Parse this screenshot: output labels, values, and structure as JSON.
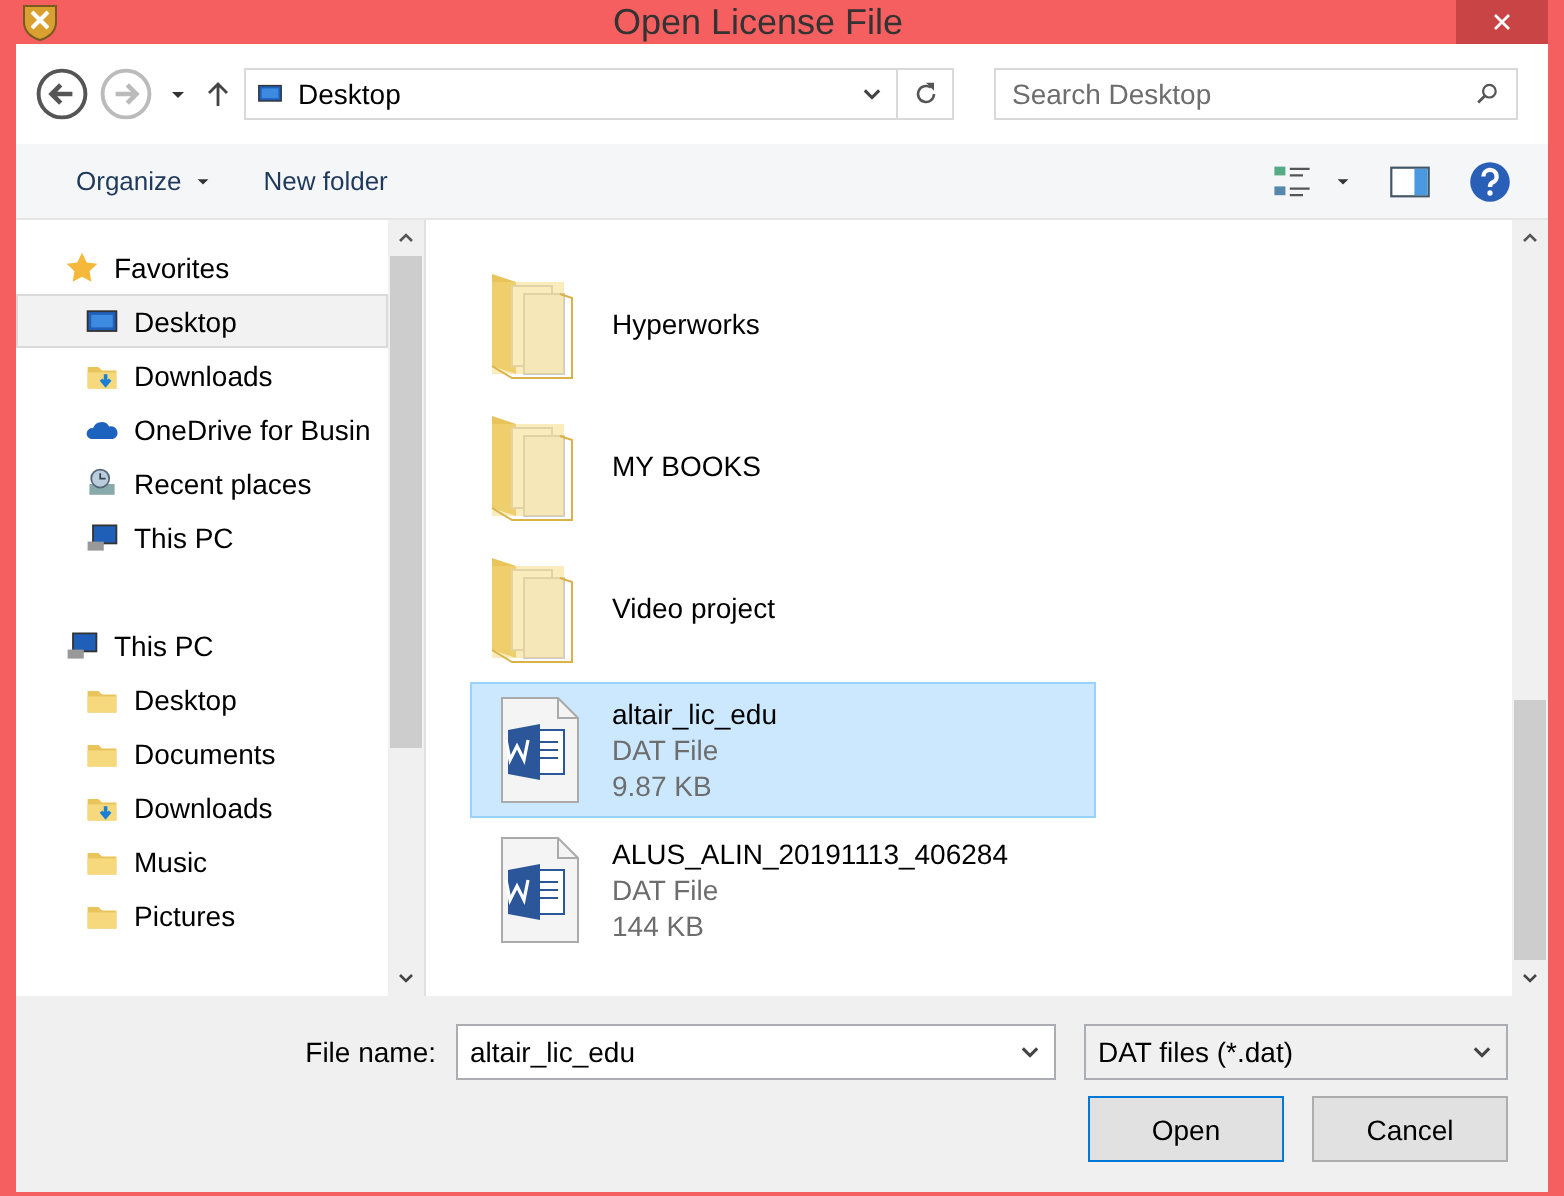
{
  "window": {
    "title": "Open License File"
  },
  "address": {
    "path": "Desktop"
  },
  "search": {
    "placeholder": "Search Desktop"
  },
  "toolbar": {
    "organize": "Organize",
    "new_folder": "New folder"
  },
  "navigation": [
    {
      "label": "Favorites",
      "kind": "star",
      "selected": false,
      "children": [
        {
          "label": "Desktop",
          "kind": "desktop",
          "selected": true
        },
        {
          "label": "Downloads",
          "kind": "downloads",
          "selected": false
        },
        {
          "label": "OneDrive for Busin",
          "kind": "cloud",
          "selected": false
        },
        {
          "label": "Recent places",
          "kind": "recent",
          "selected": false
        },
        {
          "label": "This PC",
          "kind": "pc",
          "selected": false
        }
      ]
    },
    {
      "label": "This PC",
      "kind": "pc",
      "selected": false,
      "children": [
        {
          "label": "Desktop",
          "kind": "folder",
          "selected": false
        },
        {
          "label": "Documents",
          "kind": "folder",
          "selected": false
        },
        {
          "label": "Downloads",
          "kind": "downloads",
          "selected": false
        },
        {
          "label": "Music",
          "kind": "folder",
          "selected": false
        },
        {
          "label": "Pictures",
          "kind": "folder",
          "selected": false
        }
      ]
    }
  ],
  "files": [
    {
      "name": "Hyperworks",
      "kind": "folder",
      "selected": false
    },
    {
      "name": "MY BOOKS",
      "kind": "folder",
      "selected": false
    },
    {
      "name": "Video project",
      "kind": "folder",
      "selected": false
    },
    {
      "name": "altair_lic_edu",
      "kind": "document",
      "type": "DAT File",
      "size": "9.87 KB",
      "selected": true
    },
    {
      "name": "ALUS_ALIN_20191113_406284",
      "kind": "document",
      "type": "DAT File",
      "size": "144 KB",
      "selected": false
    }
  ],
  "file_name": {
    "label": "File name:",
    "value": "altair_lic_edu"
  },
  "file_type": {
    "value": "DAT files (*.dat)"
  },
  "buttons": [
    {
      "label": "Open",
      "kind": "default"
    },
    {
      "label": "Cancel",
      "kind": "normal"
    }
  ]
}
